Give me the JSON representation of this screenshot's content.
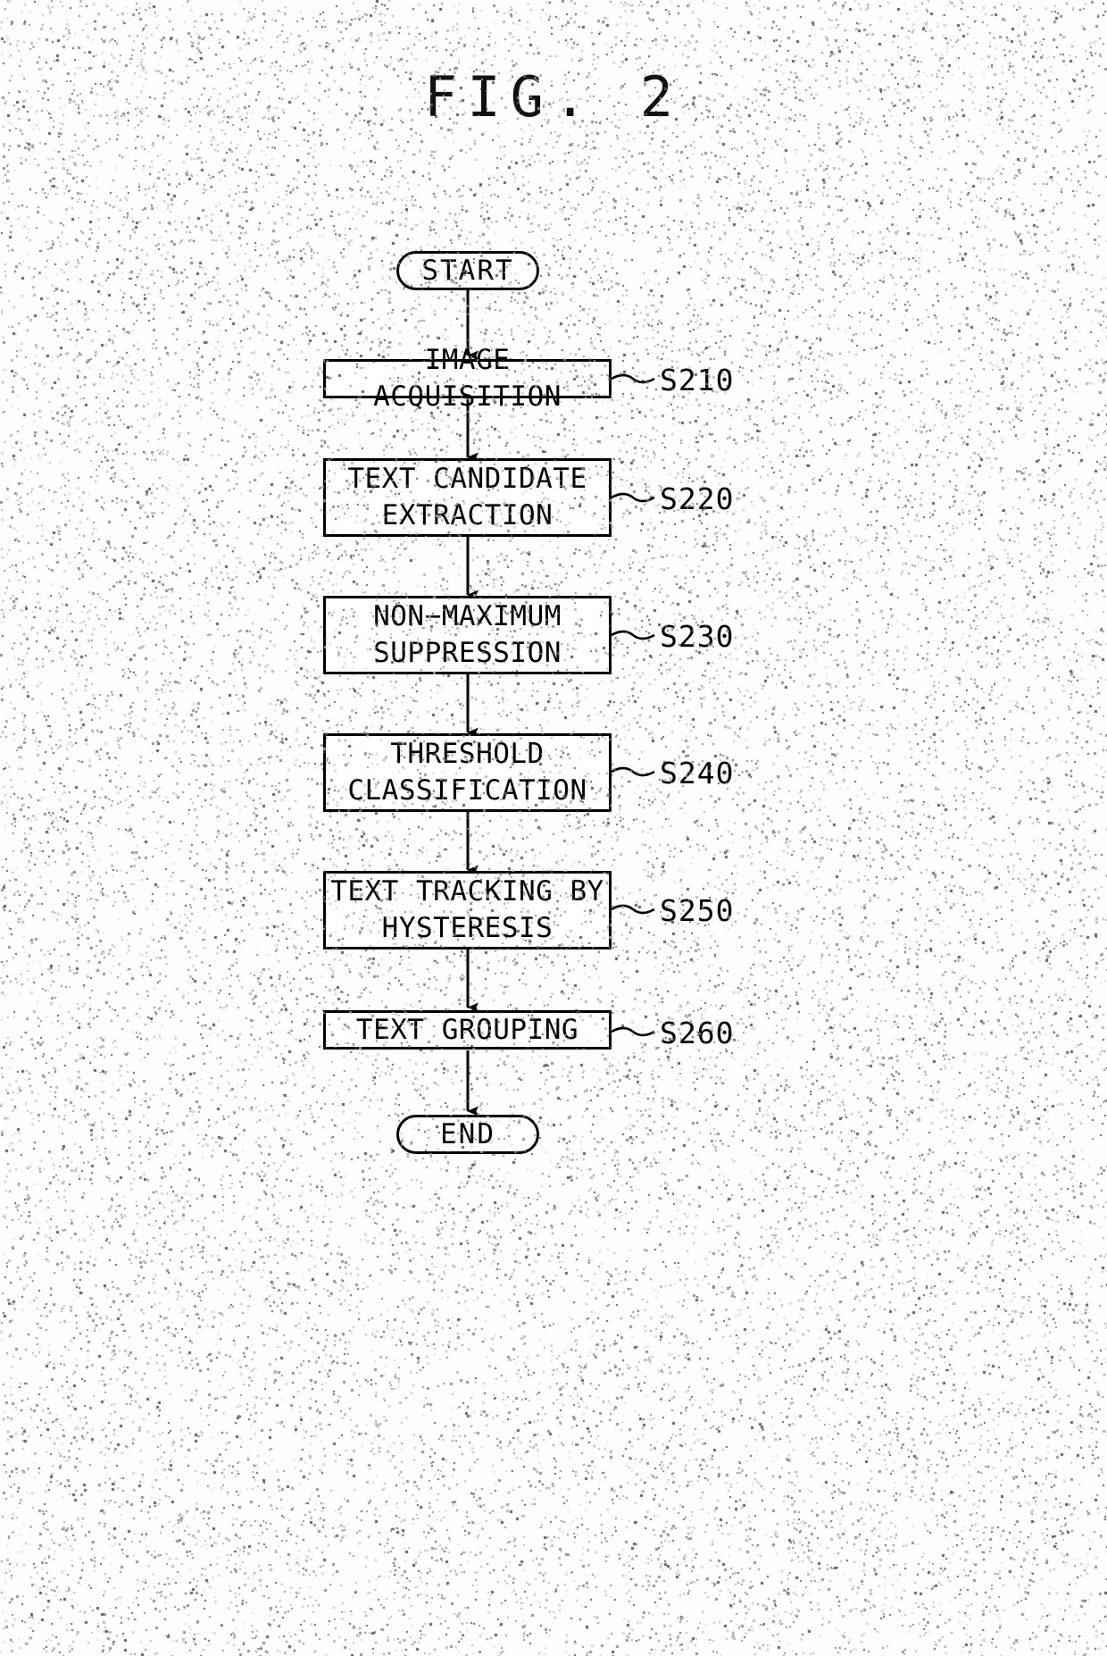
{
  "figure": {
    "title": "FIG. 2"
  },
  "flowchart": {
    "type": "flowchart",
    "orientation": "top-to-bottom",
    "start_label": "START",
    "end_label": "END",
    "steps": [
      {
        "id": "S210",
        "text": "IMAGE ACQUISITION",
        "lines": [
          "IMAGE ACQUISITION"
        ]
      },
      {
        "id": "S220",
        "text": "TEXT CANDIDATE EXTRACTION",
        "lines": [
          "TEXT CANDIDATE",
          "EXTRACTION"
        ]
      },
      {
        "id": "S230",
        "text": "NON-MAXIMUM SUPPRESSION",
        "lines": [
          "NON−MAXIMUM",
          "SUPPRESSION"
        ]
      },
      {
        "id": "S240",
        "text": "THRESHOLD CLASSIFICATION",
        "lines": [
          "THRESHOLD",
          "CLASSIFICATION"
        ]
      },
      {
        "id": "S250",
        "text": "TEXT TRACKING BY HYSTERESIS",
        "lines": [
          "TEXT TRACKING BY",
          "HYSTERESIS"
        ]
      },
      {
        "id": "S260",
        "text": "TEXT GROUPING",
        "lines": [
          "TEXT GROUPING"
        ]
      }
    ],
    "connectors": [
      {
        "from": "START",
        "to": "S210"
      },
      {
        "from": "S210",
        "to": "S220"
      },
      {
        "from": "S220",
        "to": "S230"
      },
      {
        "from": "S230",
        "to": "S240"
      },
      {
        "from": "S240",
        "to": "S250"
      },
      {
        "from": "S250",
        "to": "S260"
      },
      {
        "from": "S260",
        "to": "END"
      }
    ],
    "colors": {
      "ink": "#000000",
      "paper": "#ffffff"
    }
  },
  "step_text": {
    "s210_l1": "IMAGE ACQUISITION",
    "s220_l1": "TEXT CANDIDATE",
    "s220_l2": "EXTRACTION",
    "s230_l1": "NON−MAXIMUM",
    "s230_l2": "SUPPRESSION",
    "s240_l1": "THRESHOLD",
    "s240_l2": "CLASSIFICATION",
    "s250_l1": "TEXT TRACKING BY",
    "s250_l2": "HYSTERESIS",
    "s260_l1": "TEXT GROUPING"
  },
  "step_ids": {
    "s210": "S210",
    "s220": "S220",
    "s230": "S230",
    "s240": "S240",
    "s250": "S250",
    "s260": "S260"
  },
  "terminals": {
    "start": "START",
    "end": "END"
  }
}
